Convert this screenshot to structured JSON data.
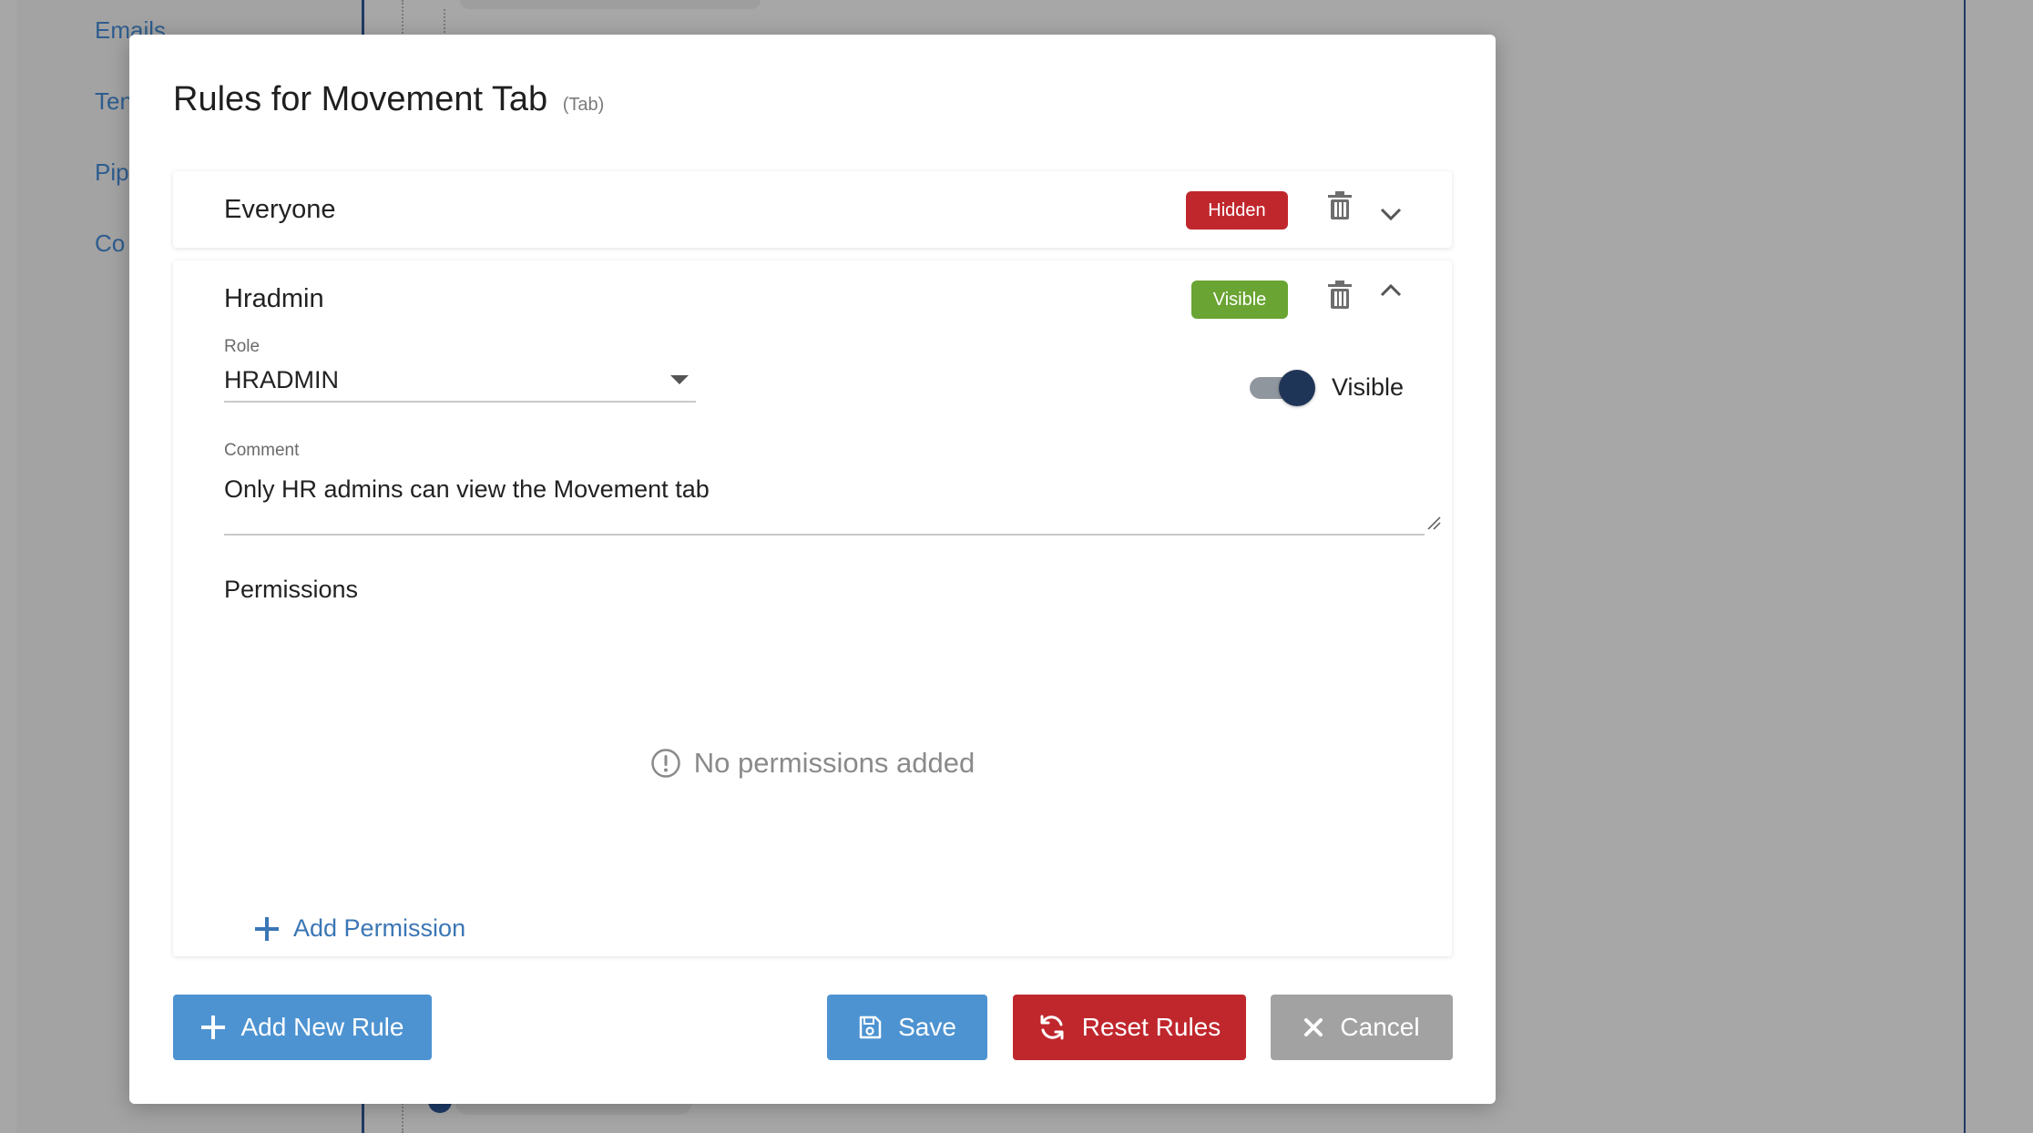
{
  "background": {
    "nav_links": [
      "Emails",
      "Ten",
      "Pip",
      "Co"
    ]
  },
  "modal": {
    "title": "Rules for Movement Tab",
    "subtitle": "(Tab)"
  },
  "rules": [
    {
      "name": "Everyone",
      "status": "Hidden",
      "expanded": false
    },
    {
      "name": "Hradmin",
      "status": "Visible",
      "expanded": true,
      "role_label": "Role",
      "role_value": "HRADMIN",
      "toggle_label": "Visible",
      "toggle_on": true,
      "comment_label": "Comment",
      "comment_value": "Only HR admins can view the Movement tab",
      "permissions_title": "Permissions",
      "permissions_empty": "No permissions added",
      "add_permission_label": "Add Permission"
    }
  ],
  "footer": {
    "add_rule_label": "Add New Rule",
    "save_label": "Save",
    "reset_label": "Reset Rules",
    "cancel_label": "Cancel"
  },
  "colors": {
    "hidden_badge": "#c0272d",
    "visible_badge": "#6aa432",
    "primary": "#4d93d1",
    "danger": "#c0272d",
    "neutral": "#a2a2a2",
    "toggle_knob": "#1f3558"
  },
  "icons": [
    "trash-icon",
    "chevron-down-icon",
    "chevron-up-icon",
    "caret-down-icon",
    "info-circle-icon",
    "plus-icon",
    "floppy-disk-icon",
    "refresh-icon",
    "close-icon"
  ]
}
